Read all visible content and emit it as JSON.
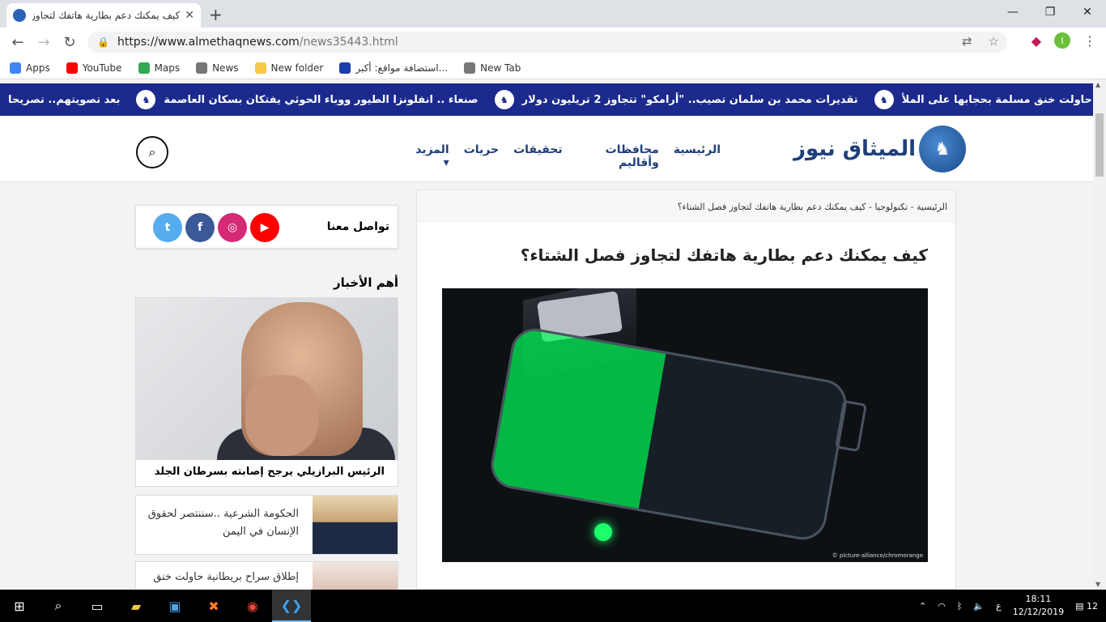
{
  "browser": {
    "tab_title": "كيف يمكنك دعم بطارية هاتفك لتجاوز فصل الشتاء؟",
    "url_host": "https://www.almethaqnews.com",
    "url_path": "/news35443.html",
    "profile_initial": "I"
  },
  "bookmarks": [
    {
      "label": "Apps",
      "icon": "apps-grid-icon",
      "color": "#4285f4"
    },
    {
      "label": "YouTube",
      "icon": "youtube-icon",
      "color": "#ff0000"
    },
    {
      "label": "Maps",
      "icon": "maps-icon",
      "color": "#34a853"
    },
    {
      "label": "News",
      "icon": "globe-icon",
      "color": "#777777"
    },
    {
      "label": "New folder",
      "icon": "folder-icon",
      "color": "#f7c948"
    },
    {
      "label": "استضافة مواقع: أكبر...",
      "icon": "hosting-icon",
      "color": "#1a3ea8"
    },
    {
      "label": "New Tab",
      "icon": "globe-icon",
      "color": "#777777"
    }
  ],
  "ticker": [
    "سراح بريطانية حاولت خنق مسلمة بحجابها على الملأ",
    "تقديرات محمد بن سلمان تصيب.. \"أرامكو\" تتجاوز 2 تريليون دولار",
    "صنعاء .. انفلونزا الطيور ووباء الحوثي يفتكان بسكان العاصمة",
    "بعد تصويتهم.. تصريحا"
  ],
  "site": {
    "logo_text": "الميثاق نيوز",
    "nav": [
      "الرئيسية",
      "محافظات وأقاليم",
      "تحقيقات",
      "حريات",
      "المزيد ▾"
    ],
    "breadcrumb": "الرئيسية - تكنولوجيا - كيف يمكنك دعم بطارية هاتفك لتجاوز فصل الشتاء؟",
    "article_title": "كيف يمكنك دعم بطارية هاتفك لتجاوز فصل الشتاء؟",
    "image_credit": "© picture-alliance/chromorange",
    "social_label": "تواصل معنا",
    "top_news_label": "أهم الأخبار",
    "featured_caption": "الرئيس البرازيلي يرجح إصابته بسرطان الجلد",
    "side_items": [
      "الحكومة الشرعية ..سننتصر لحقوق الإنسان في اليمن",
      "إطلاق سراح بريطانية حاولت خنق"
    ]
  },
  "taskbar": {
    "time": "18:11",
    "date": "12/12/2019",
    "lang": "ع",
    "notifications": "12"
  }
}
